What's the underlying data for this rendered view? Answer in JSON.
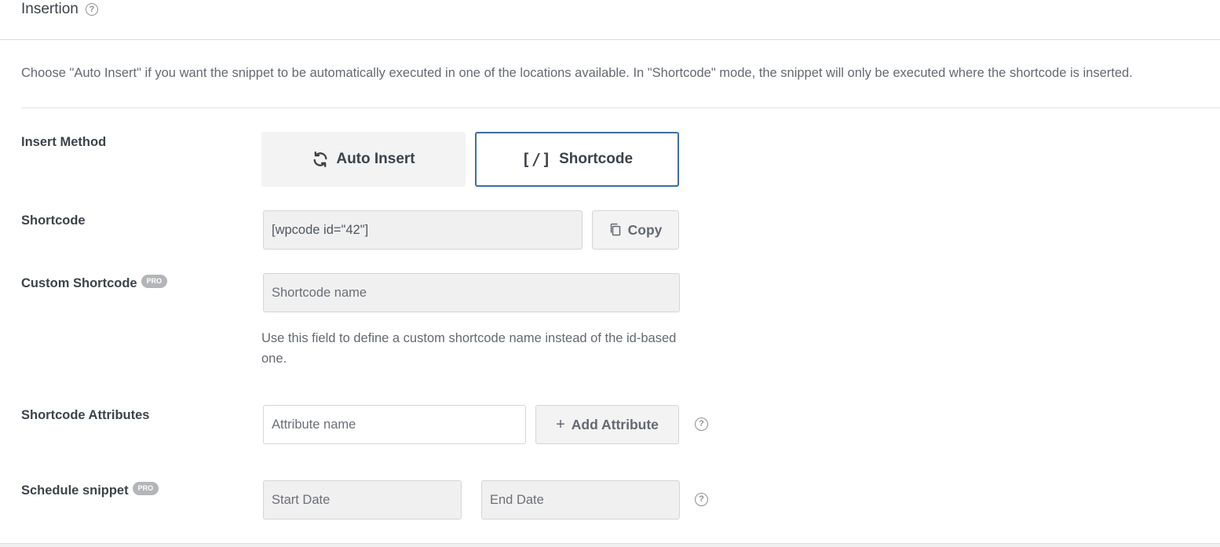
{
  "section": {
    "title": "Insertion"
  },
  "description": "Choose \"Auto Insert\" if you want the snippet to be automatically executed in one of the locations available. In \"Shortcode\" mode, the snippet will only be executed where the shortcode is inserted.",
  "insert_method": {
    "label": "Insert Method",
    "options": [
      {
        "label": "Auto Insert",
        "icon": "refresh-icon",
        "selected": false
      },
      {
        "label": "Shortcode",
        "icon": "[/]",
        "selected": true
      }
    ]
  },
  "shortcode": {
    "label": "Shortcode",
    "value": "[wpcode id=\"42\"]",
    "copy_label": "Copy"
  },
  "custom_shortcode": {
    "label": "Custom Shortcode",
    "badge": "PRO",
    "placeholder": "Shortcode name",
    "hint": "Use this field to define a custom shortcode name instead of the id-based one."
  },
  "shortcode_attributes": {
    "label": "Shortcode Attributes",
    "placeholder": "Attribute name",
    "add_label": "Add Attribute"
  },
  "schedule": {
    "label": "Schedule snippet",
    "badge": "PRO",
    "start_placeholder": "Start Date",
    "end_placeholder": "End Date"
  },
  "colors": {
    "selected_border": "#3e6ea5",
    "field_bg": "#f0f0f0",
    "text": "#3c434a",
    "muted": "#646970"
  }
}
